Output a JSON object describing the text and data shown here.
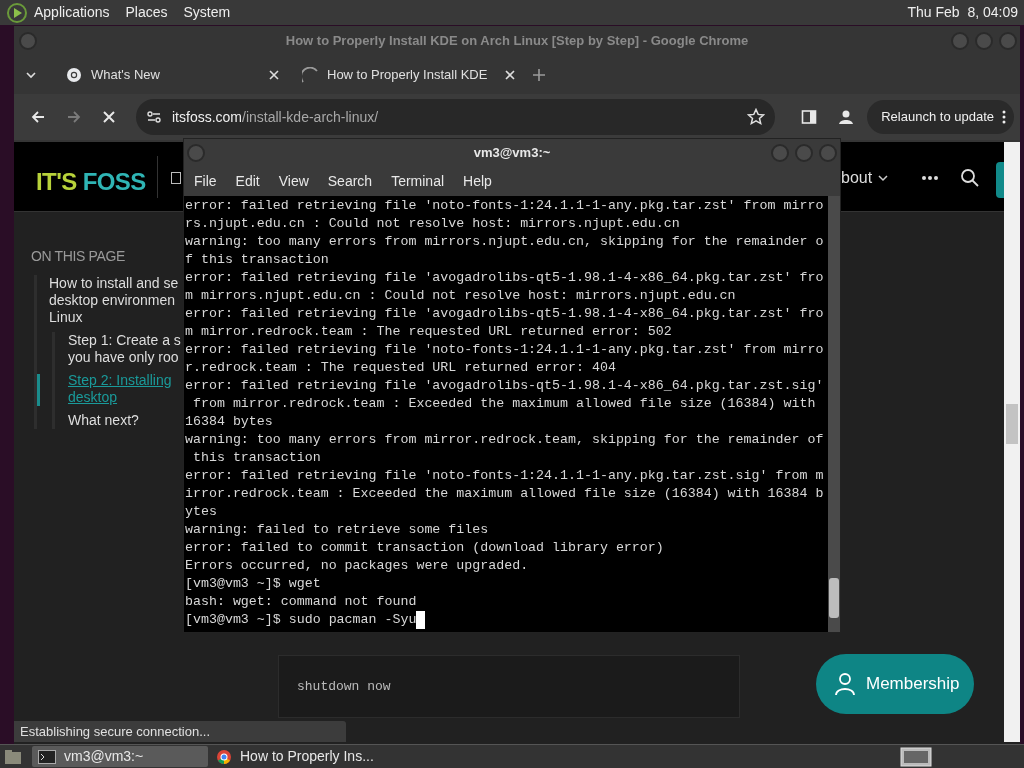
{
  "top_panel": {
    "menus": [
      "Applications",
      "Places",
      "System"
    ],
    "clock": "Thu Feb  8, 04:09"
  },
  "browser": {
    "title": "How to Properly Install KDE on Arch Linux [Step by Step] - Google Chrome",
    "tabs": [
      {
        "label": "What's New",
        "loading": false
      },
      {
        "label": "How to Properly Install KDE",
        "loading": true
      }
    ],
    "url": {
      "host": "itsfoss.com",
      "path": "/install-kde-arch-linux/"
    },
    "relaunch_button": "Relaunch to update",
    "page": {
      "logo": {
        "left": "IT'S",
        "right": "FOSS"
      },
      "nav_item": "bout",
      "toc_heading": "ON THIS PAGE",
      "toc": [
        {
          "lines": [
            "How to install and se",
            "desktop environmen",
            "Linux"
          ],
          "selected": false,
          "children": [
            {
              "lines": [
                "Step 1: Create a s",
                "you have only roo"
              ],
              "selected": false
            },
            {
              "lines": [
                "Step 2: Installing",
                "desktop"
              ],
              "selected": true
            },
            {
              "lines": [
                "What next?"
              ],
              "selected": false
            }
          ]
        }
      ],
      "code": "shutdown now",
      "membership_button": "Membership"
    },
    "status": "Establishing secure connection..."
  },
  "terminal": {
    "title": "vm3@vm3:~",
    "menus": [
      "File",
      "Edit",
      "View",
      "Search",
      "Terminal",
      "Help"
    ],
    "lines": [
      "error: failed retrieving file 'noto-fonts-1:24.1.1-1-any.pkg.tar.zst' from mirro",
      "rs.njupt.edu.cn : Could not resolve host: mirrors.njupt.edu.cn",
      "warning: too many errors from mirrors.njupt.edu.cn, skipping for the remainder o",
      "f this transaction",
      "error: failed retrieving file 'avogadrolibs-qt5-1.98.1-4-x86_64.pkg.tar.zst' fro",
      "m mirrors.njupt.edu.cn : Could not resolve host: mirrors.njupt.edu.cn",
      "error: failed retrieving file 'avogadrolibs-qt5-1.98.1-4-x86_64.pkg.tar.zst' fro",
      "m mirror.redrock.team : The requested URL returned error: 502",
      "error: failed retrieving file 'noto-fonts-1:24.1.1-1-any.pkg.tar.zst' from mirro",
      "r.redrock.team : The requested URL returned error: 404",
      "error: failed retrieving file 'avogadrolibs-qt5-1.98.1-4-x86_64.pkg.tar.zst.sig'",
      " from mirror.redrock.team : Exceeded the maximum allowed file size (16384) with",
      "16384 bytes",
      "warning: too many errors from mirror.redrock.team, skipping for the remainder of",
      " this transaction",
      "error: failed retrieving file 'noto-fonts-1:24.1.1-1-any.pkg.tar.zst.sig' from m",
      "irror.redrock.team : Exceeded the maximum allowed file size (16384) with 16384 b",
      "ytes",
      "warning: failed to retrieve some files",
      "error: failed to commit transaction (download library error)",
      "Errors occurred, no packages were upgraded.",
      "[vm3@vm3 ~]$ wget",
      "bash: wget: command not found",
      "[vm3@vm3 ~]$ sudo pacman -Syu"
    ]
  },
  "taskbar": [
    {
      "label": "vm3@vm3:~",
      "kind": "terminal",
      "selected": true
    },
    {
      "label": "How to Properly Ins...",
      "kind": "browser",
      "selected": false
    }
  ]
}
